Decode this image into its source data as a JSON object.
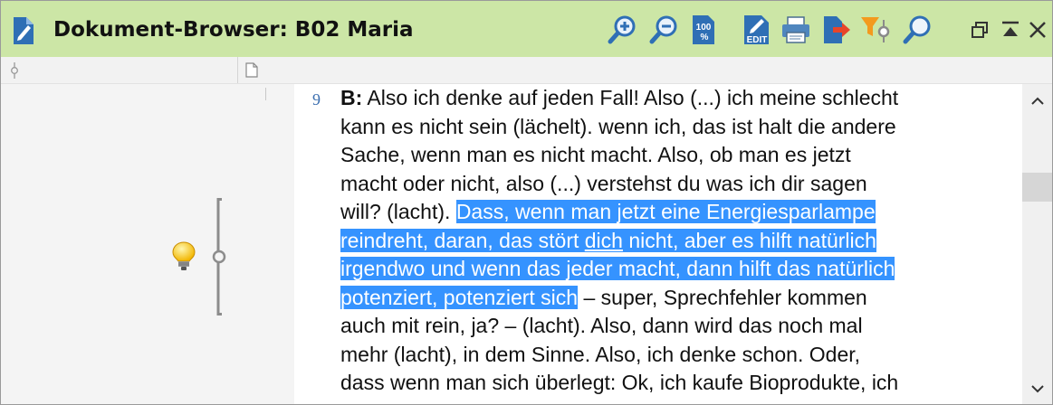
{
  "window": {
    "title": "Dokument-Browser: B02 Maria"
  },
  "toolbar": {
    "icons": [
      "zoom-in-icon",
      "zoom-out-icon",
      "zoom-100-icon",
      "edit-icon",
      "print-icon",
      "export-icon",
      "filter-icon",
      "search-icon"
    ],
    "zoom100_label": "100 %",
    "edit_label": "EDIT",
    "window_controls": [
      "restore-icon",
      "dock-top-icon",
      "close-icon"
    ]
  },
  "document": {
    "line_number": "9",
    "speaker": "B:",
    "lines": [
      {
        "parts": [
          {
            "t": " Also ich denke auf jeden Fall! Also (...) ich meine schlecht"
          }
        ]
      },
      {
        "parts": [
          {
            "t": "kann es nicht sein (lächelt). wenn ich, das ist halt die andere"
          }
        ]
      },
      {
        "parts": [
          {
            "t": "Sache, wenn man es nicht macht. Also, ob man es jetzt"
          }
        ]
      },
      {
        "parts": [
          {
            "t": "macht oder nicht, also (...) verstehst du was ich dir sagen"
          }
        ]
      },
      {
        "parts": [
          {
            "t": "will? (lacht). "
          },
          {
            "t": "Dass, wenn man jetzt eine Energiesparlampe",
            "hl": true
          }
        ]
      },
      {
        "parts": [
          {
            "t": "reindreht, daran, das stört ",
            "hl": true
          },
          {
            "t": "dich",
            "hl": true,
            "u": true
          },
          {
            "t": " nicht, aber es hilft natürlich",
            "hl": true
          }
        ]
      },
      {
        "parts": [
          {
            "t": "irgendwo und wenn das jeder macht, dann hilft das natürlich",
            "hl": true
          }
        ]
      },
      {
        "parts": [
          {
            "t": "potenziert, potenziert sich",
            "hl": true
          },
          {
            "t": " – super, Sprechfehler kommen"
          }
        ]
      },
      {
        "parts": [
          {
            "t": "auch mit rein, ja? – (lacht). Also, dann wird das noch mal"
          }
        ]
      },
      {
        "parts": [
          {
            "t": "mehr (lacht),  in dem Sinne. Also, ich denke schon. Oder,"
          }
        ]
      },
      {
        "parts": [
          {
            "t": "dass wenn man sich überlegt: Ok, ich kaufe Bioprodukte, ich"
          }
        ]
      }
    ]
  },
  "colors": {
    "titlebar": "#cce6a6",
    "highlight": "#3593ff",
    "line_number": "#3c6fb0"
  }
}
